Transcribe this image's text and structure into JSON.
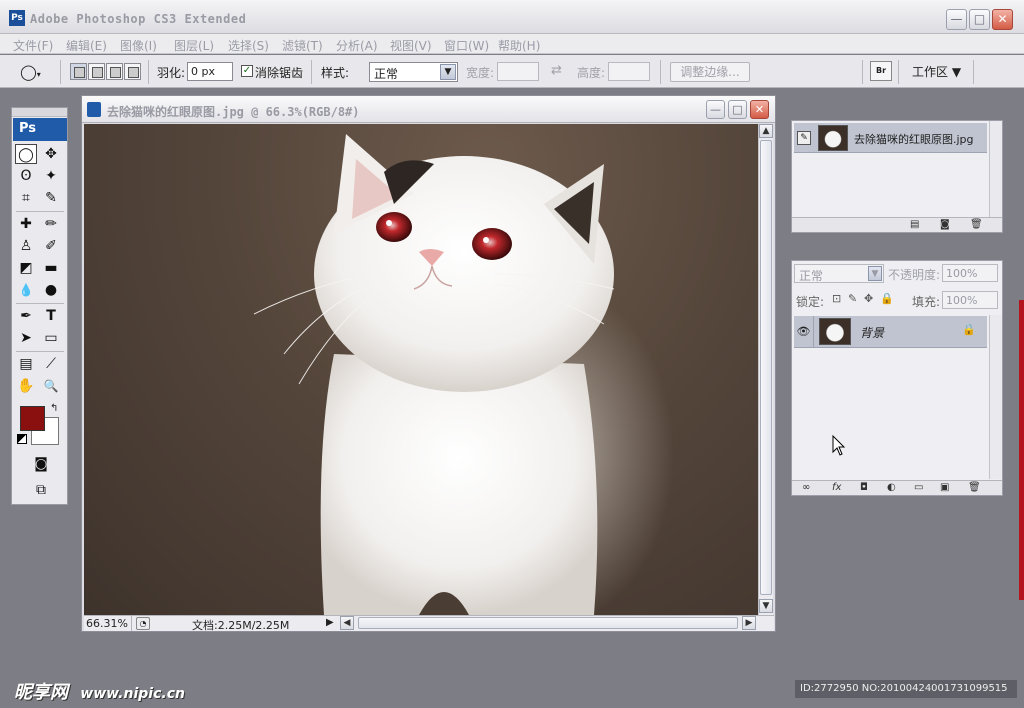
{
  "app": {
    "title": "Adobe Photoshop CS3 Extended",
    "logo": "Ps"
  },
  "window_controls": {
    "minimize": "—",
    "maximize": "□",
    "close": "✕"
  },
  "menus": [
    "文件(F)",
    "编辑(E)",
    "图像(I)",
    "图层(L)",
    "选择(S)",
    "滤镜(T)",
    "分析(A)",
    "视图(V)",
    "窗口(W)",
    "帮助(H)"
  ],
  "options": {
    "feather_label": "羽化:",
    "feather_value": "0 px",
    "antialias_label": "消除锯齿",
    "antialias_checked": true,
    "style_label": "样式:",
    "style_value": "正常",
    "width_label": "宽度:",
    "height_label": "高度:",
    "refine_edge": "调整边缘...",
    "workspace": "工作区 ▼",
    "swap_icon": "⇄"
  },
  "toolbox": {
    "logo": "Ps",
    "tools": [
      {
        "name": "elliptical-marquee-tool",
        "glyph": "◯"
      },
      {
        "name": "move-tool",
        "glyph": "✥"
      },
      {
        "name": "lasso-tool",
        "glyph": "ʘ"
      },
      {
        "name": "magic-wand-tool",
        "glyph": "✦"
      },
      {
        "name": "crop-tool",
        "glyph": "⌗"
      },
      {
        "name": "slice-tool",
        "glyph": "✎"
      },
      {
        "name": "healing-brush-tool",
        "glyph": "✚"
      },
      {
        "name": "brush-tool",
        "glyph": "✏"
      },
      {
        "name": "clone-stamp-tool",
        "glyph": "♙"
      },
      {
        "name": "history-brush-tool",
        "glyph": "✐"
      },
      {
        "name": "eraser-tool",
        "glyph": "◩"
      },
      {
        "name": "gradient-tool",
        "glyph": "▬"
      },
      {
        "name": "blur-tool",
        "glyph": "💧"
      },
      {
        "name": "dodge-tool",
        "glyph": "●"
      },
      {
        "name": "pen-tool",
        "glyph": "✒"
      },
      {
        "name": "type-tool",
        "glyph": "T"
      },
      {
        "name": "path-selection-tool",
        "glyph": "➤"
      },
      {
        "name": "rectangle-tool",
        "glyph": "▭"
      },
      {
        "name": "notes-tool",
        "glyph": "▤"
      },
      {
        "name": "eyedropper-tool",
        "glyph": "⟋"
      },
      {
        "name": "hand-tool",
        "glyph": "✋"
      },
      {
        "name": "zoom-tool",
        "glyph": "🔍"
      }
    ],
    "foreground_color": "#8a1010",
    "background_color": "#ffffff",
    "quick_mask_glyph": "◙",
    "screen_mode_glyph": "⧉"
  },
  "document": {
    "title": "去除猫咪的红眼原图.jpg @ 66.3%(RGB/8#)",
    "zoom": "66.31%",
    "info": "文档:2.25M/2.25M",
    "eye_color": "#c0282c"
  },
  "history": {
    "snapshot_name": "去除猫咪的红眼原图.jpg"
  },
  "layers": {
    "blend_mode": "正常",
    "opacity_label": "不透明度:",
    "opacity_value": "100%",
    "lock_label": "锁定:",
    "fill_label": "填充:",
    "fill_value": "100%",
    "layer_name": "背景"
  },
  "watermark": {
    "text": "昵享网",
    "url": "www.nipic.cn"
  },
  "image_id": "ID:2772950 NO:20100424001731099515"
}
